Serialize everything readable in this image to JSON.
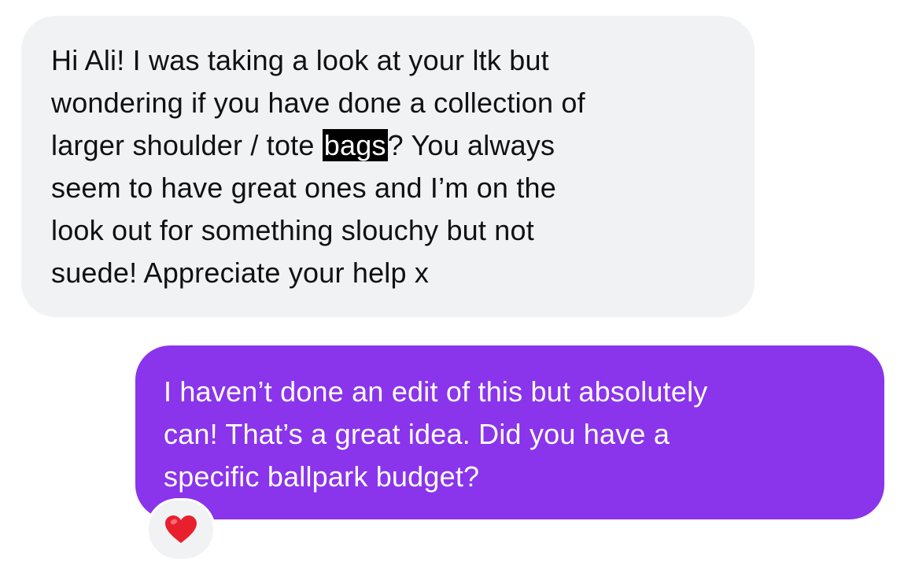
{
  "conversation": {
    "incoming_message": {
      "line1": "Hi Ali! I was taking a look at your ltk but",
      "line2": "wondering if you have done a collection of",
      "line3_before": "larger shoulder / tote ",
      "line3_highlight": "bags",
      "line3_after": "? You always",
      "line4": "seem to have great ones and I’m on the",
      "line5": "look out for something slouchy but not",
      "line6": "suede! Appreciate your help x"
    },
    "outgoing_message": {
      "line1": "I haven’t done an edit of this but absolutely",
      "line2": "can! That’s a great idea. Did you have a",
      "line3": "specific ballpark budget?"
    },
    "reaction": {
      "icon": "red-heart-icon"
    }
  },
  "colors": {
    "incoming_bubble": "#f1f2f4",
    "outgoing_bubble": "#8a34ec",
    "highlight": "#000000",
    "heart": "#e8202e"
  }
}
